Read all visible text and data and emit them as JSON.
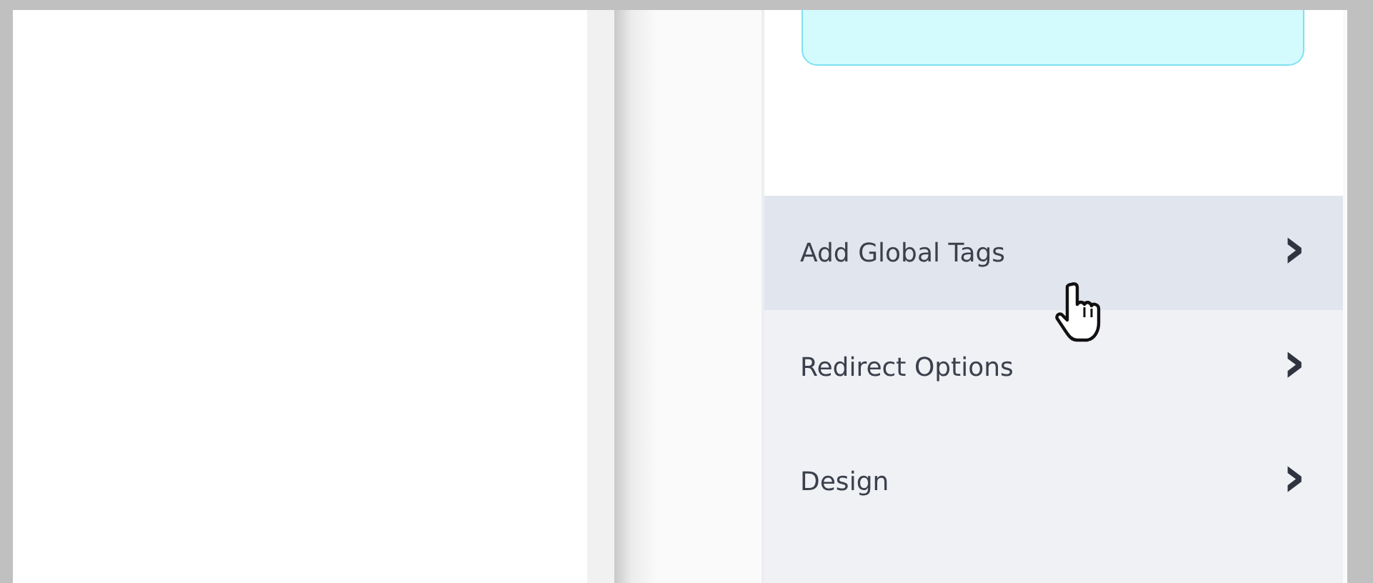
{
  "settings_menu": {
    "items": [
      {
        "label": "Add Global Tags",
        "highlighted": true,
        "chevron": "›"
      },
      {
        "label": "Redirect Options",
        "highlighted": false,
        "chevron": "›"
      },
      {
        "label": "Design",
        "highlighted": false,
        "chevron": "›"
      }
    ]
  }
}
